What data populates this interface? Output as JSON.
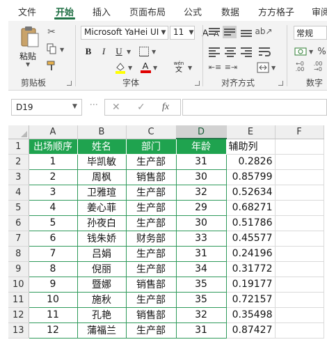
{
  "ribbon_tabs": [
    "文件",
    "开始",
    "插入",
    "页面布局",
    "公式",
    "数据",
    "方方格子",
    "审阅"
  ],
  "active_tab": "开始",
  "clipboard": {
    "paste_label": "粘贴",
    "group_label": "剪贴板"
  },
  "font": {
    "font_name": "Microsoft YaHei UI",
    "font_size": "11",
    "bold_label": "B",
    "italic_label": "I",
    "underline_label": "U",
    "group_label": "字体",
    "grow_label": "A",
    "shrink_label": "A",
    "phonetic_label": "wén",
    "phonetic_sub": "文"
  },
  "alignment": {
    "group_label": "对齐方式"
  },
  "number": {
    "format": "常规",
    "group_label": "数字"
  },
  "formula_bar": {
    "name_box": "D19",
    "fx_label": "fx",
    "formula": ""
  },
  "sheet": {
    "columns": [
      "A",
      "B",
      "C",
      "D",
      "E",
      "F"
    ],
    "selected_column": "D",
    "row_numbers": [
      "1",
      "2",
      "3",
      "4",
      "5",
      "6",
      "7",
      "8",
      "9",
      "10",
      "11",
      "12",
      "13"
    ],
    "headers": [
      "出场顺序",
      "姓名",
      "部门",
      "年龄",
      "辅助列"
    ],
    "rows": [
      [
        "1",
        "毕凯敏",
        "生产部",
        "31",
        "0.2826"
      ],
      [
        "2",
        "周枫",
        "销售部",
        "30",
        "0.85799"
      ],
      [
        "3",
        "卫雅瑄",
        "生产部",
        "32",
        "0.52634"
      ],
      [
        "4",
        "姜心菲",
        "生产部",
        "29",
        "0.68271"
      ],
      [
        "5",
        "孙夜白",
        "生产部",
        "30",
        "0.51786"
      ],
      [
        "6",
        "钱朱娇",
        "财务部",
        "33",
        "0.45577"
      ],
      [
        "7",
        "吕娟",
        "生产部",
        "31",
        "0.24196"
      ],
      [
        "8",
        "倪丽",
        "生产部",
        "34",
        "0.31772"
      ],
      [
        "9",
        "暨娜",
        "销售部",
        "35",
        "0.19177"
      ],
      [
        "10",
        "施秋",
        "生产部",
        "35",
        "0.72157"
      ],
      [
        "11",
        "孔艳",
        "销售部",
        "32",
        "0.35498"
      ],
      [
        "12",
        "蒲福兰",
        "生产部",
        "31",
        "0.87427"
      ]
    ]
  },
  "colors": {
    "accent": "#217346",
    "header_fill": "#1fa34f",
    "header_text": "#ffffff",
    "font_color_bar": "#e00000",
    "highlight_bar": "#ffff00"
  }
}
